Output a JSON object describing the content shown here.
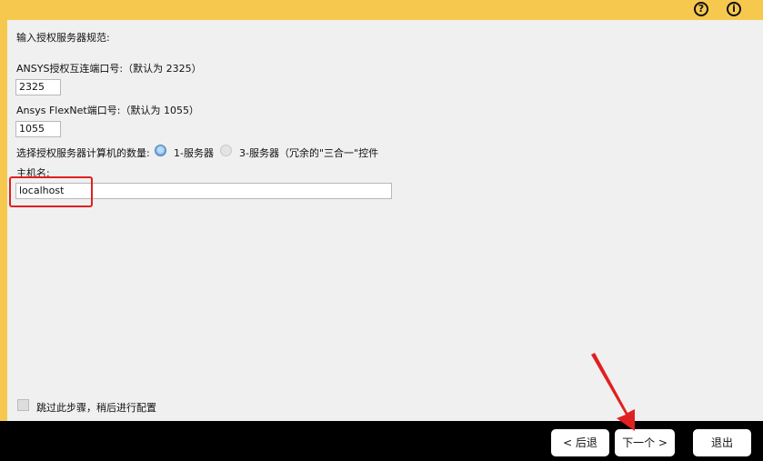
{
  "header": {
    "help_glyph": "?",
    "info_glyph": "i"
  },
  "form": {
    "intro": "输入授权服务器规范:",
    "ansys_port_label": "ANSYS授权互连端口号:（默认为 2325）",
    "ansys_port_value": "2325",
    "flexnet_port_label": "Ansys FlexNet端口号:（默认为 1055）",
    "flexnet_port_value": "1055",
    "server_count_label": "选择授权服务器计算机的数量:",
    "server_count_options": [
      {
        "label": "1-服务器",
        "selected": true
      },
      {
        "label": "3-服务器（冗余的\"三合一\"控件",
        "selected": false
      }
    ],
    "hostname_label": "主机名:",
    "hostname_value": "localhost",
    "skip_label": "跳过此步骤，稍后进行配置",
    "skip_checked": false
  },
  "footer": {
    "back_label": "< 后退",
    "next_label": "下一个 >",
    "exit_label": "退出"
  },
  "colors": {
    "accent": "#f6c94e",
    "highlight": "#e02020"
  }
}
